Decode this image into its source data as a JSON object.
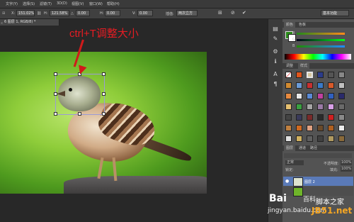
{
  "menu": {
    "items": [
      "文字(Y)",
      "选择(S)",
      "滤镜(T)",
      "3D(D)",
      "视图(V)",
      "窗口(W)",
      "帮助(H)"
    ]
  },
  "options": {
    "x_label": "X:",
    "x_value": "151.02%",
    "chain": "⛓",
    "h_label": "H:",
    "h_value": "121.58%",
    "angle_label": "△",
    "angle_value": "0.00",
    "hskew_label": "H:",
    "hskew_value": "0.00",
    "vskew_label": "V:",
    "vskew_value": "0.00",
    "interp_label": "插值:",
    "interp_value": "两次立方",
    "warp": "⊞",
    "cancel": "⊘",
    "commit": "✔",
    "workspace_value": "基本功能"
  },
  "doc_tab": "6 图层 1, RGB/8) *",
  "annotation": "ctrl+T调整大小",
  "panels": {
    "color_tabs": [
      "颜色",
      "色板"
    ],
    "channels": [
      "R",
      "G",
      "B"
    ],
    "swatch_tabs": [
      "调整",
      "样式"
    ],
    "layer_tabs": [
      "图层",
      "通道",
      "路径"
    ],
    "blend_mode": "正常",
    "opacity_label": "不透明度:",
    "opacity_value": "100%",
    "lock_label": "锁定:",
    "fill_label": "填充:",
    "fill_value": "100%",
    "layer_name": "图层 2"
  },
  "watermark": {
    "brand": "Bai",
    "brand_suffix": "百科",
    "site_cn": "脚本之家",
    "site_url": "jingyan.baidu.com",
    "site_domain": "JB51.net"
  },
  "colors": {
    "accent_annotation": "#e51c23",
    "transform_box": "#9b9bd6"
  }
}
